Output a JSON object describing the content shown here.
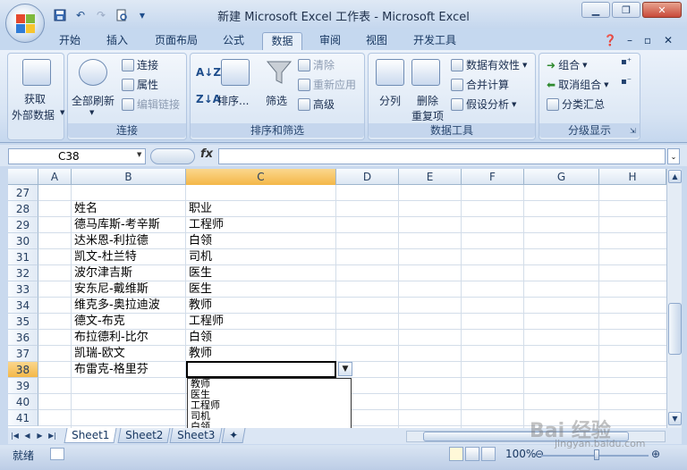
{
  "window": {
    "title": "新建 Microsoft Excel 工作表 - Microsoft Excel",
    "controls": [
      "minimize-icon",
      "restore-icon",
      "close-icon"
    ]
  },
  "quick_access": [
    "save-icon",
    "undo-icon",
    "redo-icon",
    "print-preview-icon",
    "customize-icon"
  ],
  "ribbon_tabs": [
    "开始",
    "插入",
    "页面布局",
    "公式",
    "数据",
    "审阅",
    "视图",
    "开发工具"
  ],
  "active_tab": "数据",
  "ribbon": {
    "get_external": {
      "label1": "获取",
      "label2": "外部数据"
    },
    "connections": {
      "refresh1": "全部刷新",
      "connect": "连接",
      "properties": "属性",
      "edit_links": "编辑链接",
      "group_label": "连接"
    },
    "sort_filter": {
      "sort": "排序...",
      "filter": "筛选",
      "clear": "清除",
      "reapply": "重新应用",
      "advanced": "高级",
      "group_label": "排序和筛选"
    },
    "data_tools": {
      "split": "分列",
      "remove1": "删除",
      "remove2": "重复项",
      "validation": "数据有效性",
      "consolidate": "合并计算",
      "whatif": "假设分析",
      "group_label": "数据工具"
    },
    "outline": {
      "group": "组合",
      "ungroup": "取消组合",
      "subtotal": "分类汇总",
      "group_label": "分级显示"
    }
  },
  "formula_bar": {
    "name_box": "C38",
    "fx": "fx",
    "content": ""
  },
  "columns": [
    "A",
    "B",
    "C",
    "D",
    "E",
    "F",
    "G",
    "H"
  ],
  "selected_column": "C",
  "rows": [
    {
      "num": "27",
      "b": "",
      "c": ""
    },
    {
      "num": "28",
      "b": "姓名",
      "c": "职业"
    },
    {
      "num": "29",
      "b": "德马库斯-考辛斯",
      "c": "工程师"
    },
    {
      "num": "30",
      "b": "达米恩-利拉德",
      "c": "白领"
    },
    {
      "num": "31",
      "b": "凯文-杜兰特",
      "c": "司机"
    },
    {
      "num": "32",
      "b": "波尔津吉斯",
      "c": "医生"
    },
    {
      "num": "33",
      "b": "安东尼-戴维斯",
      "c": "医生"
    },
    {
      "num": "34",
      "b": "维克多-奥拉迪波",
      "c": "教师"
    },
    {
      "num": "35",
      "b": "德文-布克",
      "c": "工程师"
    },
    {
      "num": "36",
      "b": "布拉德利-比尔",
      "c": "白领"
    },
    {
      "num": "37",
      "b": "凯瑞-欧文",
      "c": "教师"
    },
    {
      "num": "38",
      "b": "布雷克-格里芬",
      "c": ""
    },
    {
      "num": "39",
      "b": "",
      "c": ""
    },
    {
      "num": "40",
      "b": "",
      "c": ""
    },
    {
      "num": "41",
      "b": "",
      "c": ""
    }
  ],
  "selected_row": "38",
  "dropdown_options": [
    "教师",
    "医生",
    "工程师",
    "司机",
    "白领"
  ],
  "sheets": [
    "Sheet1",
    "Sheet2",
    "Sheet3"
  ],
  "active_sheet": "Sheet1",
  "status": {
    "ready": "就绪",
    "zoom": "100%"
  },
  "watermark": {
    "main": "Bai 经验",
    "sub": "jingyan.baidu.com"
  }
}
